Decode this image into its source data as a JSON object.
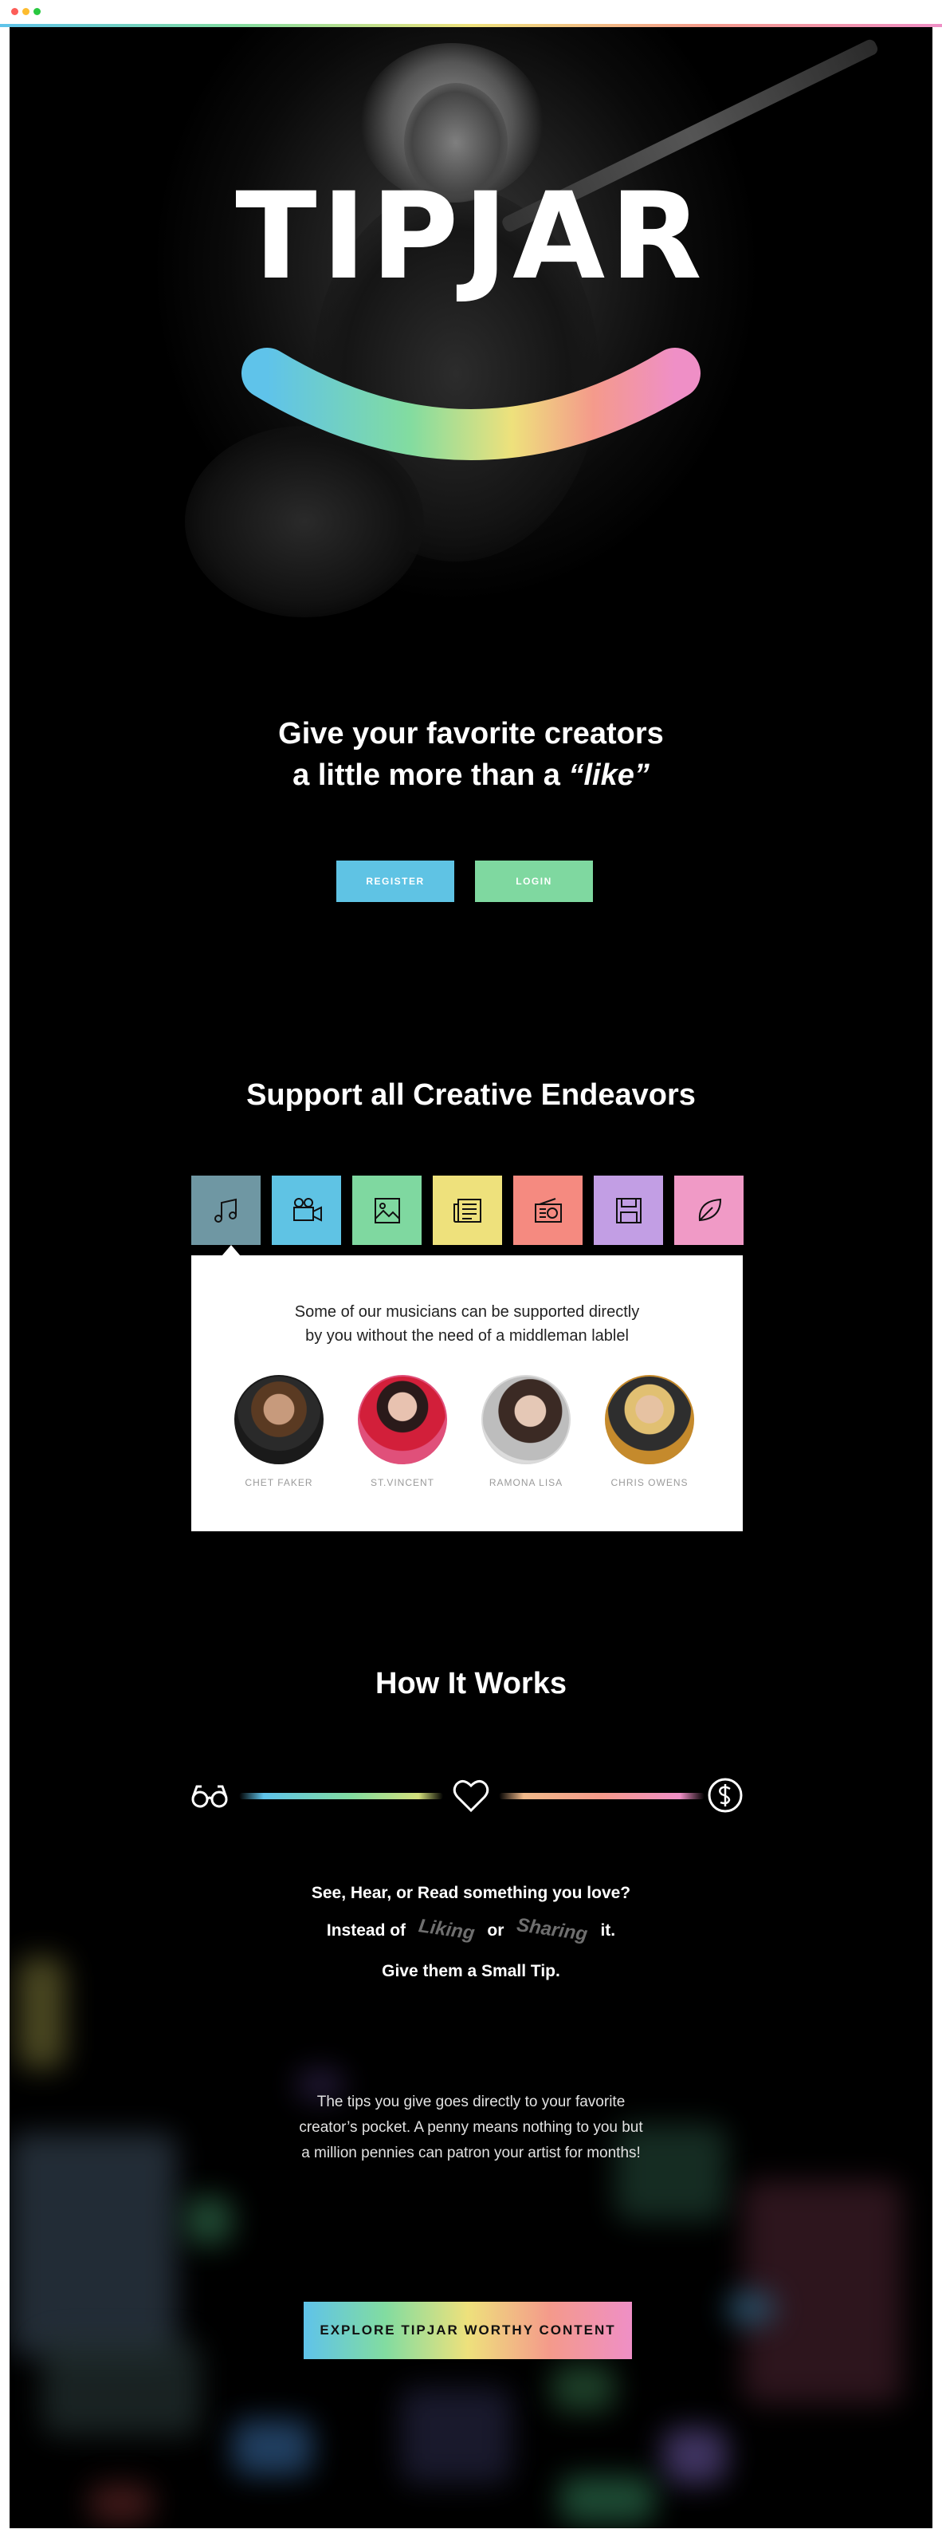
{
  "brand": {
    "logo_text": "TIPJAR",
    "rainbow_colors": [
      "#5fc3ea",
      "#82dca0",
      "#eee17c",
      "#f49a8b",
      "#ef8fc6"
    ]
  },
  "hero": {
    "headline_line1": "Give your favorite creators",
    "headline_line2_prefix": "a little more than a ",
    "headline_line2_em": "“like”"
  },
  "auth": {
    "register_label": "REGISTER",
    "login_label": "LOGIN",
    "register_color": "#5fc3e4",
    "login_color": "#7fd8a0"
  },
  "support": {
    "title": "Support all Creative Endeavors",
    "categories": [
      {
        "icon": "music-note-icon",
        "color": "#6f97a3",
        "selected": true
      },
      {
        "icon": "video-camera-icon",
        "color": "#5fc3e4",
        "selected": false
      },
      {
        "icon": "image-icon",
        "color": "#7fd8a0",
        "selected": false
      },
      {
        "icon": "newspaper-icon",
        "color": "#eee17c",
        "selected": false
      },
      {
        "icon": "radio-icon",
        "color": "#f58a80",
        "selected": false
      },
      {
        "icon": "floppy-disk-icon",
        "color": "#c29ee4",
        "selected": false
      },
      {
        "icon": "leaf-icon",
        "color": "#f09ac6",
        "selected": false
      }
    ],
    "description_line1": "Some of our musicians can be supported directly",
    "description_line2": "by you without the need of a middleman lablel",
    "artists": [
      {
        "name": "CHET FAKER",
        "ring": "#1a1a1a"
      },
      {
        "name": "ST.VINCENT",
        "ring": "#e0507a"
      },
      {
        "name": "RAMONA LISA",
        "ring": "#d9d9d9"
      },
      {
        "name": "CHRIS OWENS",
        "ring": "#c58a2c"
      }
    ]
  },
  "how": {
    "title": "How It Works",
    "line1": "See, Hear, or Read something you love?",
    "line2_prefix": "Instead of",
    "line2_ghost1": "Liking",
    "line2_or": "or",
    "line2_ghost2": "Sharing",
    "line2_suffix": "it.",
    "line3": "Give them a Small Tip.",
    "para_line1": "The tips you give goes directly to your favorite",
    "para_line2": "creator’s pocket. A penny means nothing to you but",
    "para_line3": "a million pennies can patron your artist for months!"
  },
  "cta": {
    "explore_label": "EXPLORE TIPJAR WORTHY CONTENT"
  }
}
